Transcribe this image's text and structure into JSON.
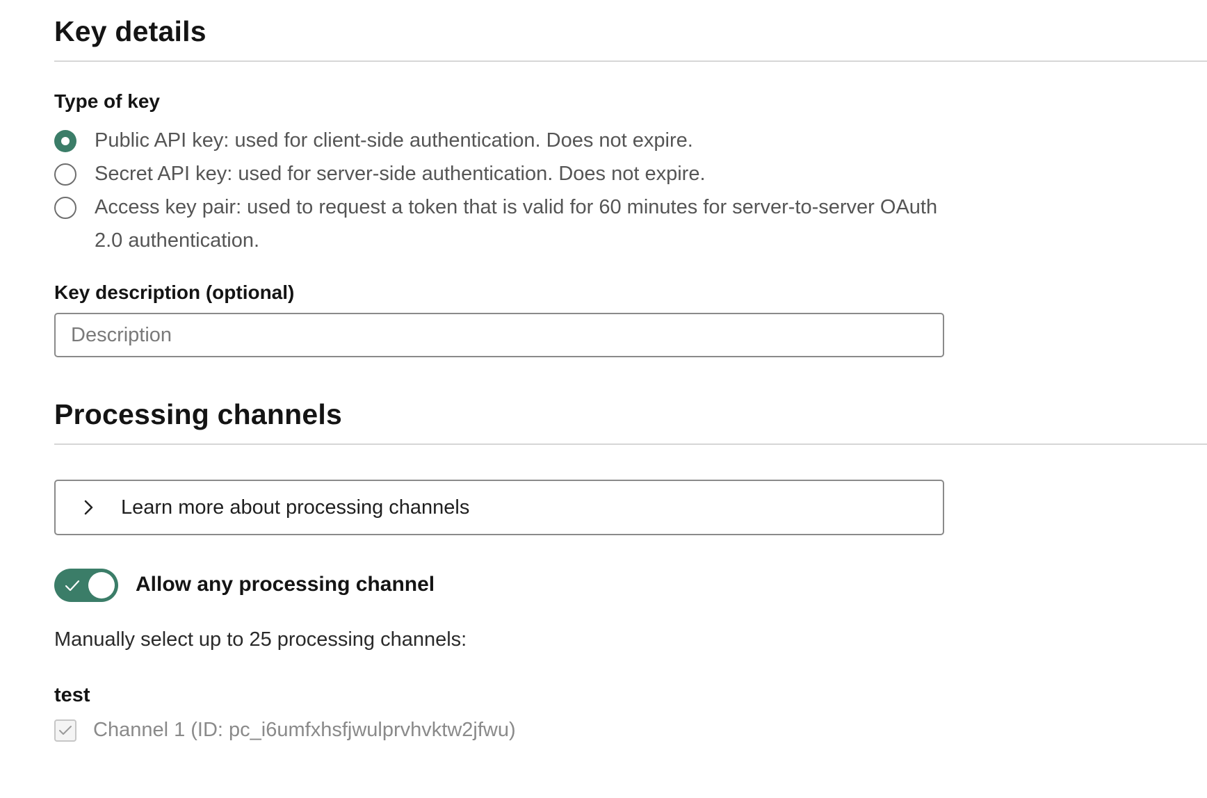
{
  "key_details": {
    "title": "Key details",
    "type_label": "Type of key",
    "options": [
      {
        "label": "Public API key: used for client-side authentication. Does not expire.",
        "selected": true
      },
      {
        "label": "Secret API key: used for server-side authentication. Does not expire.",
        "selected": false
      },
      {
        "label": "Access key pair: used to request a token that is valid for 60 minutes for server-to-server OAuth 2.0 authentication.",
        "selected": false
      }
    ],
    "description_label": "Key description (optional)",
    "description_placeholder": "Description",
    "description_value": ""
  },
  "processing_channels": {
    "title": "Processing channels",
    "learn_more": "Learn more about processing channels",
    "toggle_label": "Allow any processing channel",
    "toggle_on": true,
    "manual_text": "Manually select up to 25 processing channels:",
    "group": {
      "label": "test",
      "channels": [
        {
          "label": "Channel 1 (ID: pc_i6umfxhsfjwulprvhvktw2jfwu)",
          "checked": true,
          "disabled": true
        }
      ]
    }
  },
  "colors": {
    "accent": "#3b7d68",
    "divider": "#d6d6d6",
    "border": "#8a8a8a"
  }
}
